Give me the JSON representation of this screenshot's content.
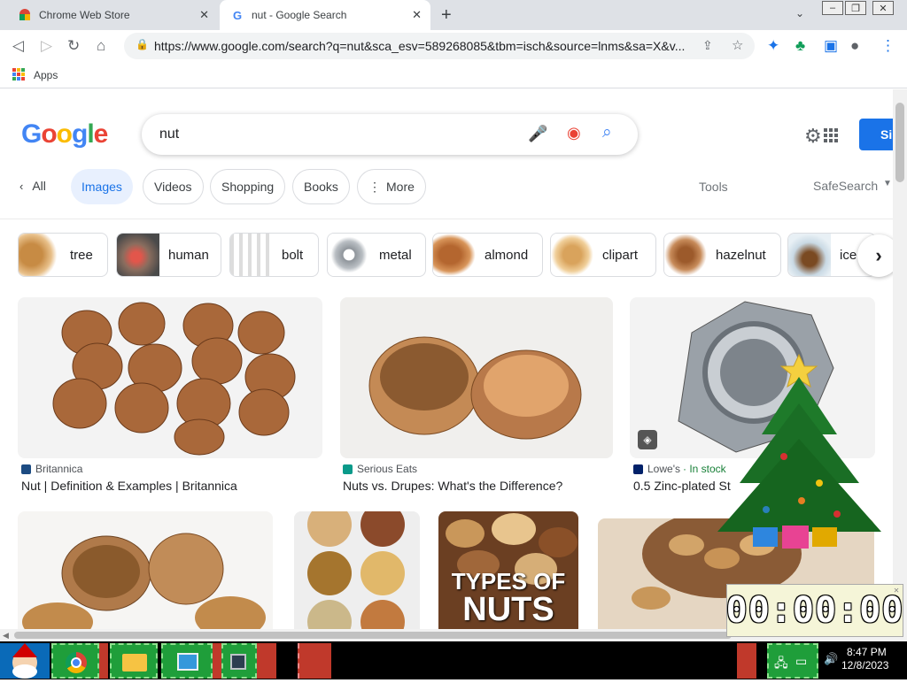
{
  "browser": {
    "tabs": [
      {
        "title": "Chrome Web Store",
        "active": false
      },
      {
        "title": "nut - Google Search",
        "active": true
      }
    ],
    "url": "https://www.google.com/search?q=nut&sca_esv=589268085&tbm=isch&source=lnms&sa=X&v...",
    "bookmarks": {
      "apps_label": "Apps"
    }
  },
  "search": {
    "query": "nut",
    "logo": "Google",
    "nav": {
      "all": "All",
      "images": "Images",
      "videos": "Videos",
      "shopping": "Shopping",
      "books": "Books",
      "more": "More",
      "tools": "Tools",
      "safesearch": "SafeSearch",
      "signin": "Si"
    },
    "filters": [
      "tree",
      "human",
      "bolt",
      "metal",
      "almond",
      "clipart",
      "hazelnut",
      "ice"
    ],
    "results_row1": [
      {
        "source": "Britannica",
        "title": "Nut | Definition & Examples | Britannica"
      },
      {
        "source": "Serious Eats",
        "title": "Nuts vs. Drupes: What's the Difference?"
      },
      {
        "source": "Lowe's",
        "stock": "· In stock",
        "title": "0.5 Zinc-plated St"
      }
    ],
    "overlay_text": [
      "TYPES OF",
      "NUTS"
    ]
  },
  "desktop": {
    "timer": "00:00:00",
    "clock_time": "8:47 PM",
    "clock_date": "12/8/2023"
  },
  "colors": {
    "google_blue": "#1a73e8",
    "tab_bar": "#dee1e6",
    "taskbar": "#000000"
  }
}
